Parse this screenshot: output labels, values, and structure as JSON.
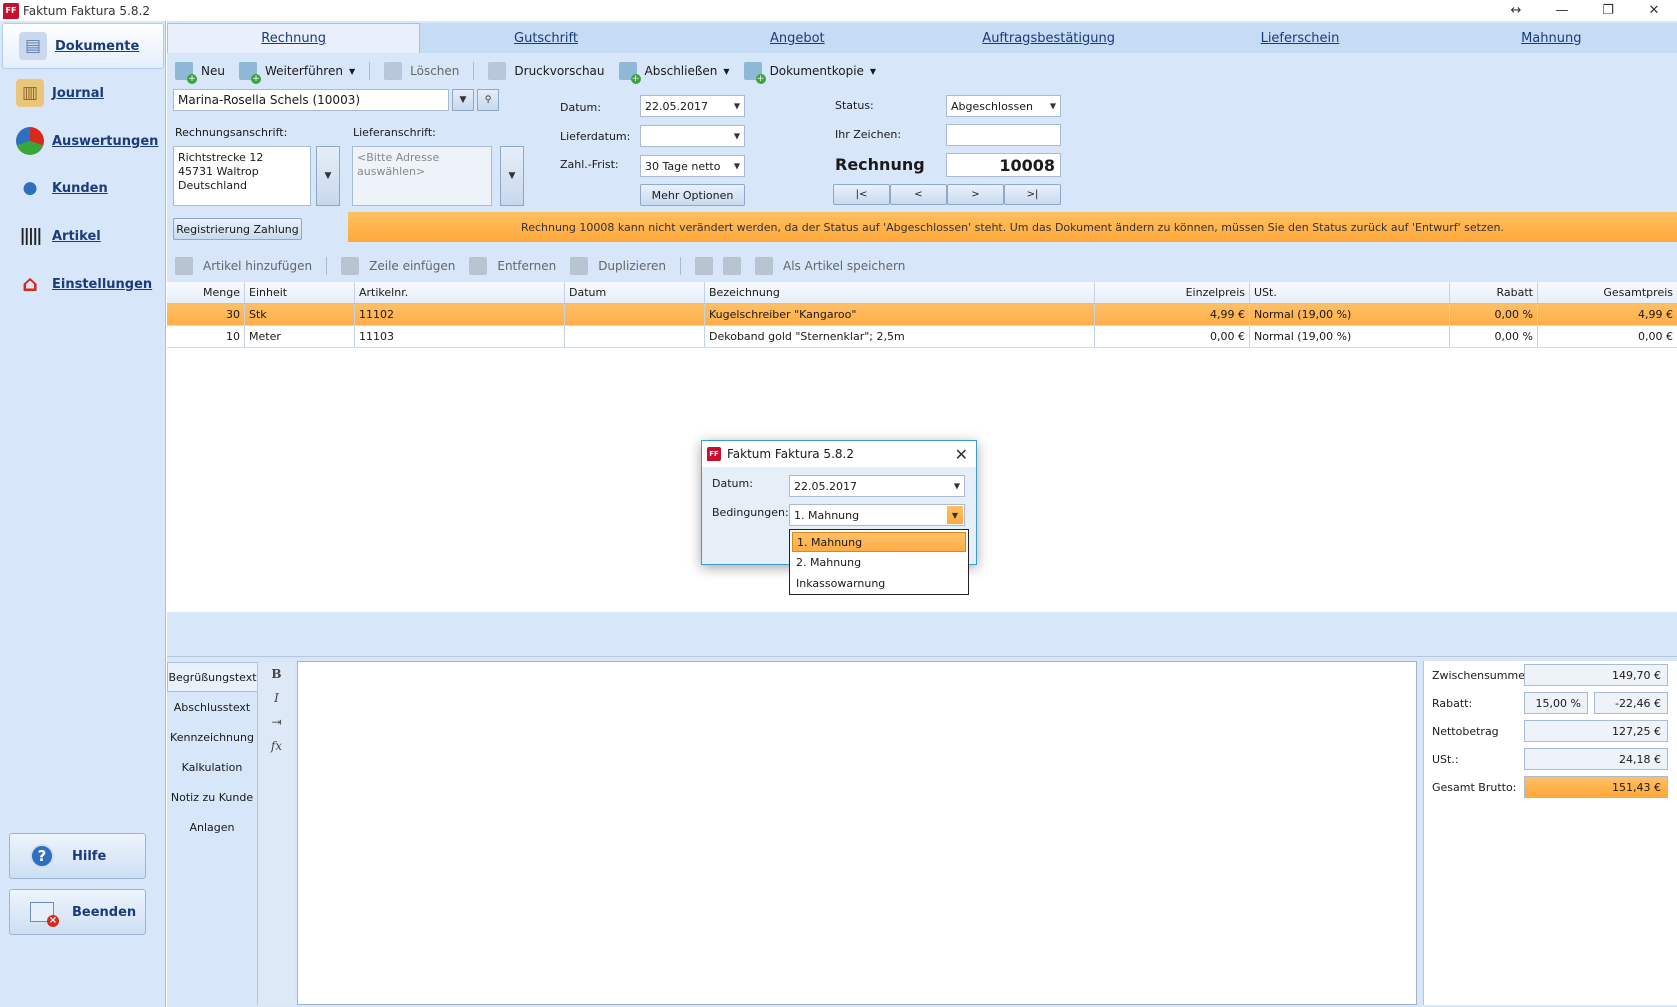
{
  "window": {
    "title": "Faktum Faktura 5.8.2",
    "logo_text": "FF",
    "controls": {
      "resize": "↔",
      "minimize": "—",
      "restore": "❐",
      "close": "✕"
    }
  },
  "nav": {
    "items": [
      {
        "label": "Dokumente",
        "icon": "document-icon",
        "color": "#5b7fb0"
      },
      {
        "label": "Journal",
        "icon": "journal-icon",
        "color": "#c99a3a"
      },
      {
        "label": "Auswertungen",
        "icon": "pie-chart-icon",
        "color": "#3aa53a"
      },
      {
        "label": "Kunden",
        "icon": "person-icon",
        "color": "#2f6fc0"
      },
      {
        "label": "Artikel",
        "icon": "barcode-icon",
        "color": "#333333"
      },
      {
        "label": "Einstellungen",
        "icon": "house-gear-icon",
        "color": "#d52b1e"
      }
    ],
    "help_label": "Hilfe",
    "help_glyph": "?",
    "exit_label": "Beenden"
  },
  "tabs": [
    "Rechnung",
    "Gutschrift",
    "Angebot",
    "Auftragsbestätigung",
    "Lieferschein",
    "Mahnung"
  ],
  "toolbar": {
    "new": "Neu",
    "continue": "Weiterführen",
    "delete": "Löschen",
    "preview": "Druckvorschau",
    "finish": "Abschließen",
    "copy": "Dokumentkopie"
  },
  "form": {
    "customer": "Marina-Rosella Schels (10003)",
    "billing_label": "Rechnungsanschrift:",
    "billing_address": [
      "Richtstrecke 12",
      "45731 Waltrop",
      "Deutschland"
    ],
    "delivery_label": "Lieferanschrift:",
    "delivery_placeholder": "<Bitte Adresse auswählen>",
    "register_payment": "Registrierung Zahlung",
    "date_label": "Datum:",
    "date_value": "22.05.2017",
    "delivery_date_label": "Lieferdatum:",
    "delivery_date_value": "",
    "payment_term_label": "Zahl.-Frist:",
    "payment_term_value": "30 Tage netto",
    "more_options": "Mehr Optionen",
    "status_label": "Status:",
    "status_value": "Abgeschlossen",
    "reference_label": "Ihr Zeichen:",
    "reference_value": "",
    "doc_type": "Rechnung",
    "doc_number": "10008",
    "nav_first": "|<",
    "nav_prev": "<",
    "nav_next": ">",
    "nav_last": ">|"
  },
  "banner": "Rechnung 10008 kann nicht verändert werden, da der Status auf 'Abgeschlossen' steht. Um das Dokument ändern zu können, müssen Sie den Status zurück auf 'Entwurf' setzen.",
  "toolbar2": {
    "add_article": "Artikel hinzufügen",
    "insert_row": "Zeile einfügen",
    "remove": "Entfernen",
    "duplicate": "Duplizieren",
    "save_as_article": "Als Artikel speichern"
  },
  "table": {
    "headers": [
      "Menge",
      "Einheit",
      "Artikelnr.",
      "Datum",
      "Bezeichnung",
      "Einzelpreis",
      "USt.",
      "Rabatt",
      "Gesamtpreis"
    ],
    "rows": [
      [
        "30",
        "Stk",
        "11102",
        "",
        "Kugelschreiber \"Kangaroo\"",
        "4,99 €",
        "Normal (19,00 %)",
        "0,00 %",
        "4,99 €"
      ],
      [
        "10",
        "Meter",
        "11103",
        "",
        "Dekoband gold \"Sternenklar\"; 2,5m",
        "0,00 €",
        "Normal (19,00 %)",
        "0,00 %",
        "0,00 €"
      ]
    ]
  },
  "side_tabs": [
    "Begrüßungstext",
    "Abschlusstext",
    "Kennzeichnung",
    "Kalkulation",
    "Notiz zu Kunde",
    "Anlagen"
  ],
  "format": {
    "bold": "B",
    "italic": "I",
    "indent": "⇥",
    "formula": "fx"
  },
  "totals": {
    "subtotal_label": "Zwischensumme:",
    "subtotal": "149,70 €",
    "discount_label": "Rabatt:",
    "discount_pct": "15,00 %",
    "discount_amount": "-22,46 €",
    "net_label": "Nettobetrag",
    "net": "127,25 €",
    "vat_label": "USt.:",
    "vat": "24,18 €",
    "gross_label": "Gesamt Brutto:",
    "gross": "151,43 €"
  },
  "dialog": {
    "title": "Faktum Faktura 5.8.2",
    "date_label": "Datum:",
    "date_value": "22.05.2017",
    "conditions_label": "Bedingungen:",
    "conditions_value": "1. Mahnung",
    "options": [
      "1. Mahnung",
      "2. Mahnung",
      "Inkassowarnung"
    ]
  }
}
